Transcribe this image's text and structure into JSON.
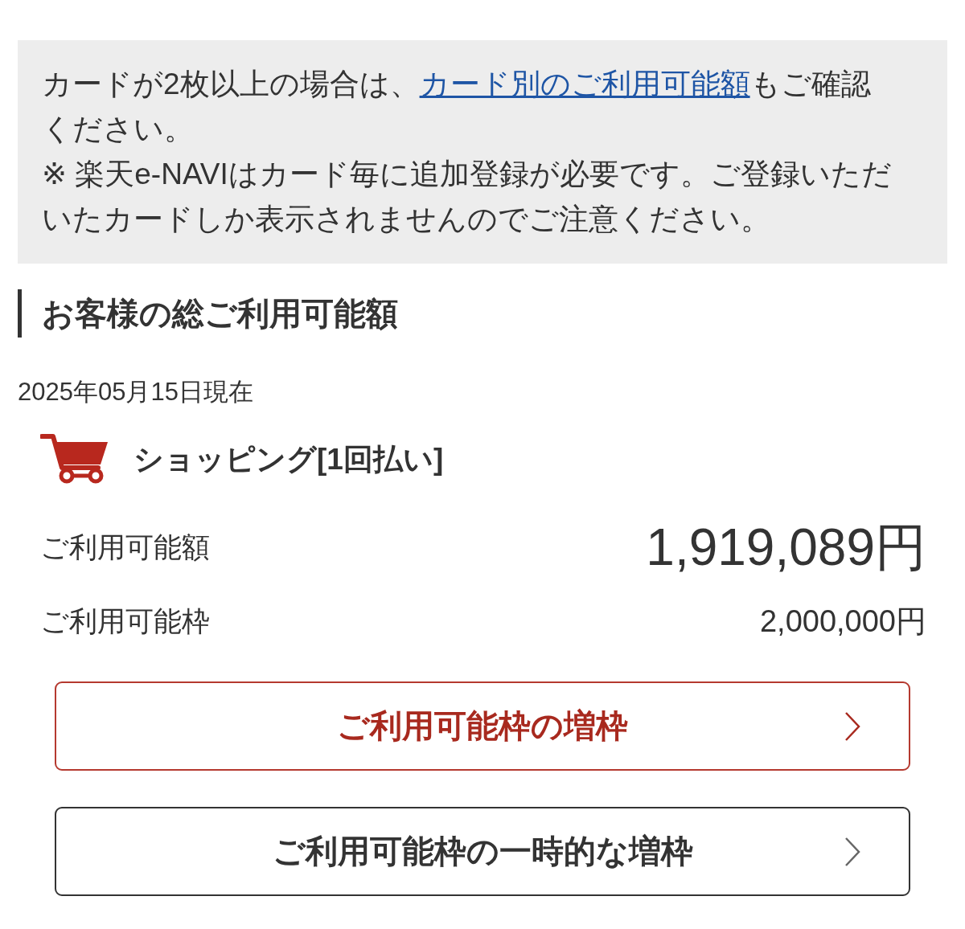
{
  "notice": {
    "text_before": "カードが2枚以上の場合は、",
    "link": "カード別のご利用可能額",
    "text_after": "もご確認ください。",
    "note": "※ 楽天e-NAVIはカード毎に追加登録が必要です。ご登録いただいたカードしか表示されませんのでご注意ください。"
  },
  "section": {
    "title": "お客様の総ご利用可能額",
    "as_of": "2025年05月15日現在"
  },
  "category": {
    "title": "ショッピング[1回払い]"
  },
  "amounts": [
    {
      "label": "ご利用可能額",
      "value": "1,919,089円",
      "kind": "primary"
    },
    {
      "label": "ご利用可能枠",
      "value": "2,000,000円",
      "kind": "secondary"
    }
  ],
  "buttons": [
    {
      "label": "ご利用可能枠の増枠",
      "kind": "primary"
    },
    {
      "label": "ご利用可能枠の一時的な増枠",
      "kind": "secondary"
    }
  ]
}
